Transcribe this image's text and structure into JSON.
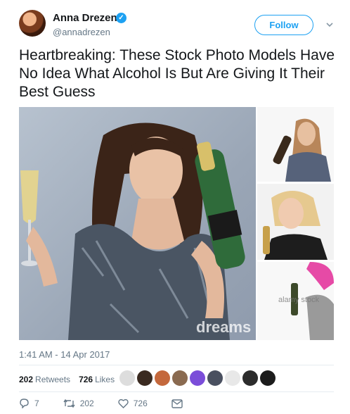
{
  "author": {
    "name": "Anna Drezen",
    "handle": "@annadrezen"
  },
  "follow_label": "Follow",
  "tweet_text": "Heartbreaking: These Stock Photo Models Have No Idea What Alcohol Is But Are Giving It Their Best Guess",
  "media": {
    "watermark_main": "dreams",
    "watermark_side": "alamy stock"
  },
  "timestamp": "1:41 AM - 14 Apr 2017",
  "stats": {
    "retweets_count": "202",
    "retweets_label": "Retweets",
    "likes_count": "726",
    "likes_label": "Likes"
  },
  "actions": {
    "reply_count": "7",
    "retweet_count": "202",
    "like_count": "726"
  },
  "colors": {
    "accent": "#1da1f2",
    "muted": "#657786",
    "text": "#14171a"
  },
  "icons": [
    "verified-icon",
    "chevron-down-icon",
    "reply-icon",
    "retweet-icon",
    "like-icon",
    "message-icon"
  ]
}
